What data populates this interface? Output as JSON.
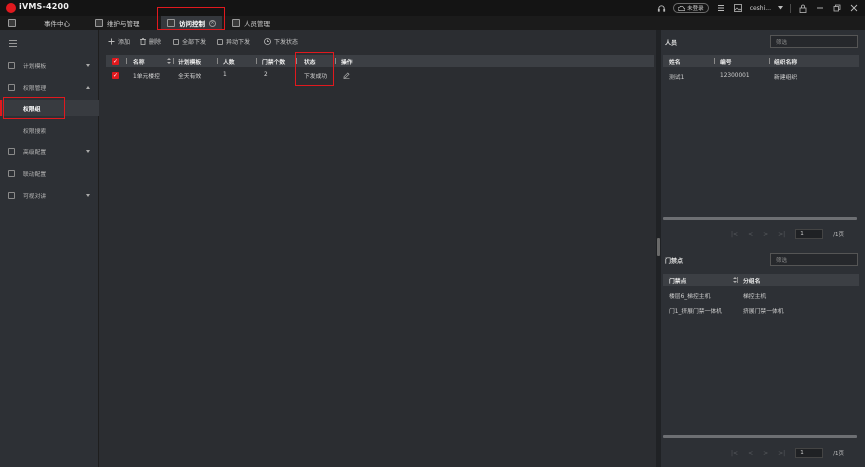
{
  "app": {
    "title": "iVMS-4200"
  },
  "titlebar": {
    "login_status": "未登录",
    "user": "ceshi..."
  },
  "tabs": [
    {
      "label": "事件中心"
    },
    {
      "label": "维护与管理"
    },
    {
      "label": "访问控制"
    },
    {
      "label": "人员管理"
    }
  ],
  "sidebar": {
    "items": [
      {
        "label": "计划模板"
      },
      {
        "label": "权限管理"
      },
      {
        "label": "权限组"
      },
      {
        "label": "权限搜索"
      },
      {
        "label": "高级配置"
      },
      {
        "label": "联动配置"
      },
      {
        "label": "可视对讲"
      }
    ]
  },
  "toolbar": {
    "add": "添加",
    "delete": "删除",
    "apply_all": "全部下发",
    "apply_changes": "异动下发",
    "apply_status": "下发状态"
  },
  "grid": {
    "columns": [
      "名称",
      "计划模板",
      "人数",
      "门禁个数",
      "状态",
      "操作"
    ],
    "rows": [
      {
        "name": "1单元楼控",
        "template": "全天有效",
        "people": "1",
        "doors": "2",
        "status": "下发成功"
      }
    ]
  },
  "persons_panel": {
    "title": "人员",
    "search_placeholder": "筛选",
    "columns": [
      "姓名",
      "编号",
      "组织名称"
    ],
    "rows": [
      {
        "name": "测试1",
        "id": "12300001",
        "org": "新建组织"
      }
    ],
    "page": "1",
    "total": "/1页"
  },
  "doors_panel": {
    "title": "门禁点",
    "search_placeholder": "筛选",
    "columns": [
      "门禁点",
      "分组名"
    ],
    "rows": [
      {
        "door": "楼层6_梯控主机",
        "group": "梯控主机"
      },
      {
        "door": "门1_挤展门禁一体机",
        "group": "挤展门禁一体机"
      }
    ],
    "page": "1",
    "total": "/1页"
  },
  "colors": {
    "accent": "#e0191e",
    "background": "#2b2d31",
    "header": "#3c3f44"
  }
}
